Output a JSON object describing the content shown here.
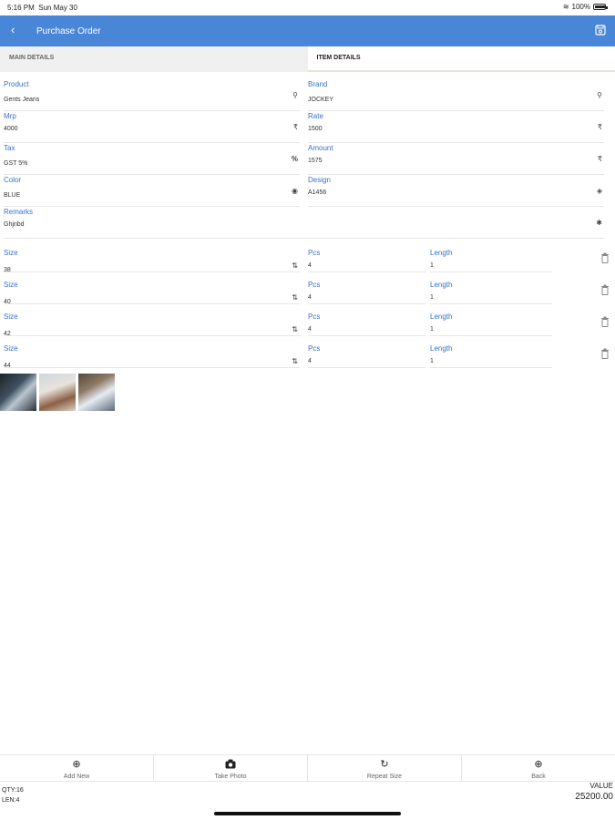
{
  "status": {
    "time": "5:16 PM",
    "date": "Sun May 30",
    "battery": "100%",
    "battery_level": 1.0
  },
  "appbar": {
    "title": "Purchase Order",
    "back_icon": "chevron-left-icon",
    "save_icon": "save-icon"
  },
  "tabs": [
    {
      "label": "MAIN DETAILS",
      "active": false
    },
    {
      "label": "ITEM DETAILS",
      "active": true
    }
  ],
  "fields": {
    "product": {
      "label": "Product",
      "value": "Gents Jeans",
      "icon": "Q"
    },
    "brand": {
      "label": "Brand",
      "value": "JOCKEY",
      "icon": "Q"
    },
    "mrp": {
      "label": "Mrp",
      "value": "4000",
      "icon": "₹"
    },
    "rate": {
      "label": "Rate",
      "value": "1500",
      "icon": "₹"
    },
    "tax": {
      "label": "Tax",
      "value": "GST 5%",
      "icon": "%"
    },
    "amount": {
      "label": "Amount",
      "value": "1575",
      "icon": "₹"
    },
    "color": {
      "label": "Color",
      "value": "BLUE",
      "icon": "◉"
    },
    "design": {
      "label": "Design",
      "value": "A1456",
      "icon": "◈"
    },
    "remarks": {
      "label": "Remarks",
      "value": "Ghjnbd",
      "icon": "✱"
    }
  },
  "size_rows": [
    {
      "size_label": "Size",
      "size": "38",
      "pcs_label": "Pcs",
      "pcs": "4",
      "length_label": "Length",
      "length": "1"
    },
    {
      "size_label": "Size",
      "size": "40",
      "pcs_label": "Pcs",
      "pcs": "4",
      "length_label": "Length",
      "length": "1"
    },
    {
      "size_label": "Size",
      "size": "42",
      "pcs_label": "Pcs",
      "pcs": "4",
      "length_label": "Length",
      "length": "1"
    },
    {
      "size_label": "Size",
      "size": "44",
      "pcs_label": "Pcs",
      "pcs": "4",
      "length_label": "Length",
      "length": "1"
    }
  ],
  "bottom_actions": [
    {
      "label": "Add New",
      "icon": "⊕"
    },
    {
      "label": "Take Photo",
      "icon": "📷"
    },
    {
      "label": "Repeat Size",
      "icon": "↻"
    },
    {
      "label": "Back",
      "icon": "⊕"
    }
  ],
  "totals": {
    "qty": "QTY:16",
    "len": "LEN:4",
    "value_label": "VALUE",
    "value": "25200.00"
  },
  "colors": {
    "primary": "#4a86d8",
    "label_blue": "#3a6fcf"
  }
}
